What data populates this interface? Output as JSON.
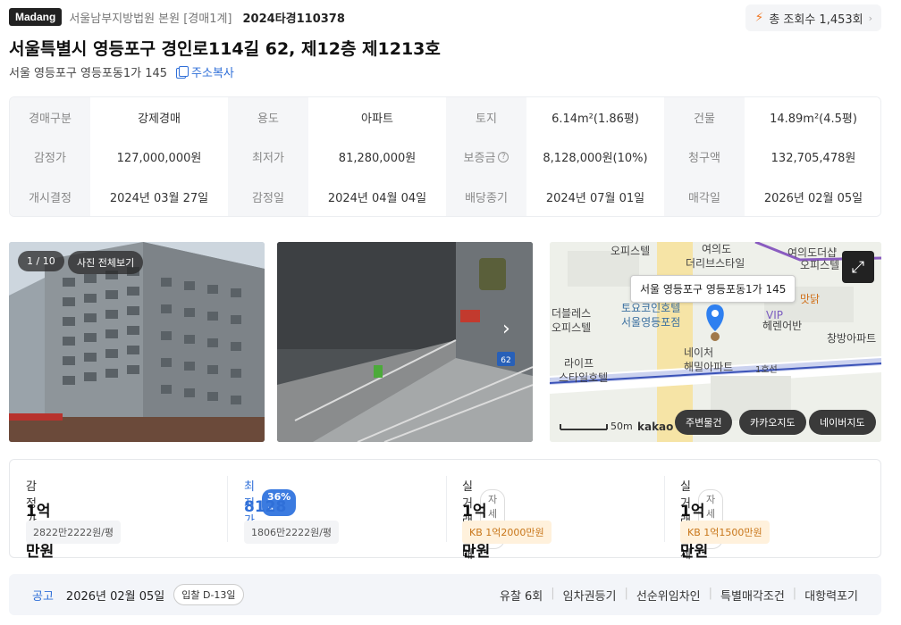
{
  "header": {
    "brand": "Madang",
    "court": "서울남부지방법원 본원 [경매1계]",
    "case_no": "2024타경110378",
    "views_label": "총 조회수 1,453회"
  },
  "address": {
    "title": "서울특별시 영등포구 경인로114길 62, 제12층 제1213호",
    "lot": "서울 영등포구 영등포동1가 145",
    "copy_label": "주소복사"
  },
  "info_grid": [
    [
      "경매구분",
      "강제경매",
      "용도",
      "아파트",
      "토지",
      "6.14m²(1.86평)",
      "건물",
      "14.89m²(4.5평)"
    ],
    [
      "감정가",
      "127,000,000원",
      "최저가",
      "81,280,000원",
      "보증금",
      "8,128,000원(10%)",
      "청구액",
      "132,705,478원"
    ],
    [
      "개시결정",
      "2024년 03월 27일",
      "감정일",
      "2024년 04월 04일",
      "배당종기",
      "2024년 07월 01일",
      "매각일",
      "2026년 02월 05일"
    ]
  ],
  "gallery": {
    "counter": "1 / 10",
    "view_all": "사진 전체보기",
    "door_number": "62"
  },
  "map": {
    "address_label": "서울 영등포구 영등포동1가 145",
    "labels": [
      "오피스텔",
      "여의도",
      "더리브스타일",
      "여의도더샵",
      "오피스텔",
      "더블레스",
      "오피스텔",
      "토요코인호텔",
      "서울영등포점",
      "VIP",
      "맛닭",
      "창방아파트",
      "라이프",
      "스타일호텔",
      "헤렌어반",
      "네이처",
      "해밀아파트",
      "1호선"
    ],
    "scale": "50m",
    "provider": "kakao",
    "buttons": [
      "주변물건",
      "카카오지도",
      "네이버지도"
    ]
  },
  "prices": {
    "appraisal": {
      "label": "감정가",
      "value": "1억2700만원",
      "sub": "2822만2222원/평"
    },
    "minimum": {
      "label": "최저가",
      "badge": "36%",
      "value": "8128만원",
      "sub": "1806만2222원/평"
    },
    "sale": {
      "label": "실거래 매매",
      "detail": "자세히",
      "value": "1억2700만원",
      "sub": "KB 1억2000만원"
    },
    "jeonse": {
      "label": "실거래 전세",
      "detail": "자세히",
      "value": "1억2000만원",
      "sub": "KB 1억1500만원"
    }
  },
  "notice": {
    "label": "공고",
    "date": "2026년 02월 05일",
    "dday": "입찰 D-13일",
    "links": [
      "유찰 6회",
      "임차권등기",
      "선순위임차인",
      "특별매각조건",
      "대항력포기"
    ]
  },
  "colors": {
    "accent": "#2f6fd8",
    "brand": "#222222",
    "map_pin": "#2f80f0",
    "kb": "#c8761a"
  }
}
